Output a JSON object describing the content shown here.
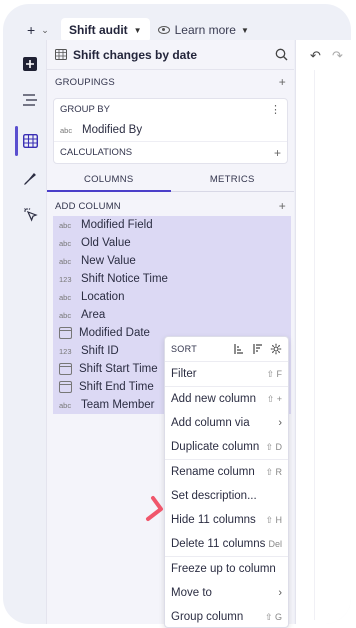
{
  "topbar": {
    "add_label": "+",
    "add_caret": "⌄",
    "active_tab": "Shift audit",
    "learn_more": "Learn more"
  },
  "panel": {
    "title": "Shift changes by date",
    "groupings_label": "GROUPINGS",
    "group_by_label": "GROUP BY",
    "group_by_item": {
      "type": "abc",
      "label": "Modified By"
    },
    "calculations_label": "CALCULATIONS",
    "tabs": [
      {
        "label": "COLUMNS",
        "active": true
      },
      {
        "label": "METRICS",
        "active": false
      }
    ],
    "add_column_label": "ADD COLUMN",
    "columns": [
      {
        "type": "abc",
        "label": "Modified Field"
      },
      {
        "type": "abc",
        "label": "Old Value"
      },
      {
        "type": "abc",
        "label": "New Value"
      },
      {
        "type": "123",
        "label": "Shift Notice Time"
      },
      {
        "type": "abc",
        "label": "Location"
      },
      {
        "type": "abc",
        "label": "Area"
      },
      {
        "type": "calendar",
        "label": "Modified Date"
      },
      {
        "type": "123",
        "label": "Shift ID"
      },
      {
        "type": "calendar",
        "label": "Shift Start Time"
      },
      {
        "type": "calendar",
        "label": "Shift End Time"
      },
      {
        "type": "abc",
        "label": "Team Member"
      }
    ]
  },
  "menu": {
    "sort_label": "SORT",
    "items": [
      {
        "label": "Filter",
        "shortcut": "⇧ F",
        "submenu": false
      },
      {
        "label": "Add new column",
        "shortcut": "⇧ +",
        "submenu": false
      },
      {
        "label": "Add column via",
        "shortcut": "",
        "submenu": true
      },
      {
        "label": "Duplicate column",
        "shortcut": "⇧ D",
        "submenu": false
      },
      {
        "label": "Rename column",
        "shortcut": "⇧ R",
        "submenu": false
      },
      {
        "label": "Set description...",
        "shortcut": "",
        "submenu": false
      },
      {
        "label": "Hide 11 columns",
        "shortcut": "⇧ H",
        "submenu": false
      },
      {
        "label": "Delete 11 columns",
        "shortcut": "Del",
        "submenu": false
      },
      {
        "label": "Freeze up to column",
        "shortcut": "",
        "submenu": false
      },
      {
        "label": "Move to",
        "shortcut": "",
        "submenu": true
      },
      {
        "label": "Group column",
        "shortcut": "⇧ G",
        "submenu": false
      }
    ]
  },
  "colors": {
    "accent": "#4b3fc9",
    "selection": "#dcd9f4",
    "pointer": "#f0566b"
  }
}
